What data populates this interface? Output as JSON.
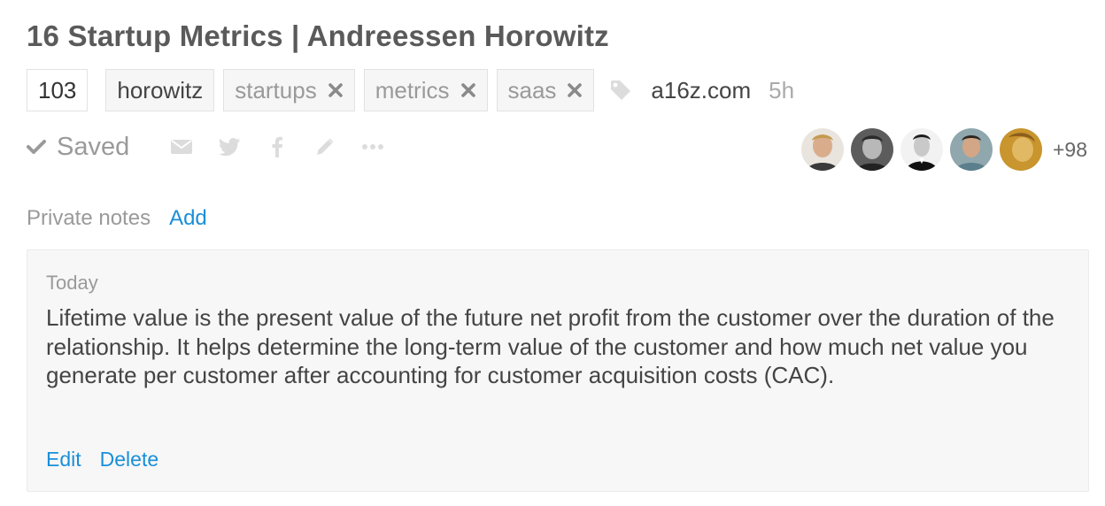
{
  "article": {
    "title": "16 Startup Metrics | Andreessen Horowitz",
    "count": "103",
    "tags": [
      {
        "label": "horowitz",
        "removable": false
      },
      {
        "label": "startups",
        "removable": true
      },
      {
        "label": "metrics",
        "removable": true
      },
      {
        "label": "saas",
        "removable": true
      }
    ],
    "domain": "a16z.com",
    "age": "5h"
  },
  "actions": {
    "saved_label": "Saved",
    "icons": [
      "envelope-icon",
      "twitter-icon",
      "facebook-icon",
      "pencil-icon",
      "ellipsis-icon"
    ]
  },
  "savers": {
    "avatar_colors": [
      "#c9a27d",
      "#6d6d6d",
      "#2e2e2e",
      "#7f9aa3",
      "#c8952e"
    ],
    "more_label": "+98"
  },
  "notes": {
    "label": "Private notes",
    "add_label": "Add",
    "items": [
      {
        "date": "Today",
        "text": "Lifetime value is the present value of the future net profit from the customer over the duration of the relationship. It helps determine the long-term value of the customer and how much net value you generate per customer after accounting for customer acquisition costs (CAC).",
        "edit_label": "Edit",
        "delete_label": "Delete"
      }
    ]
  },
  "colors": {
    "accent": "#1a8fd8",
    "muted": "#9a9a9a",
    "tag_bg": "#f6f6f6",
    "card_bg": "#f7f7f7"
  }
}
